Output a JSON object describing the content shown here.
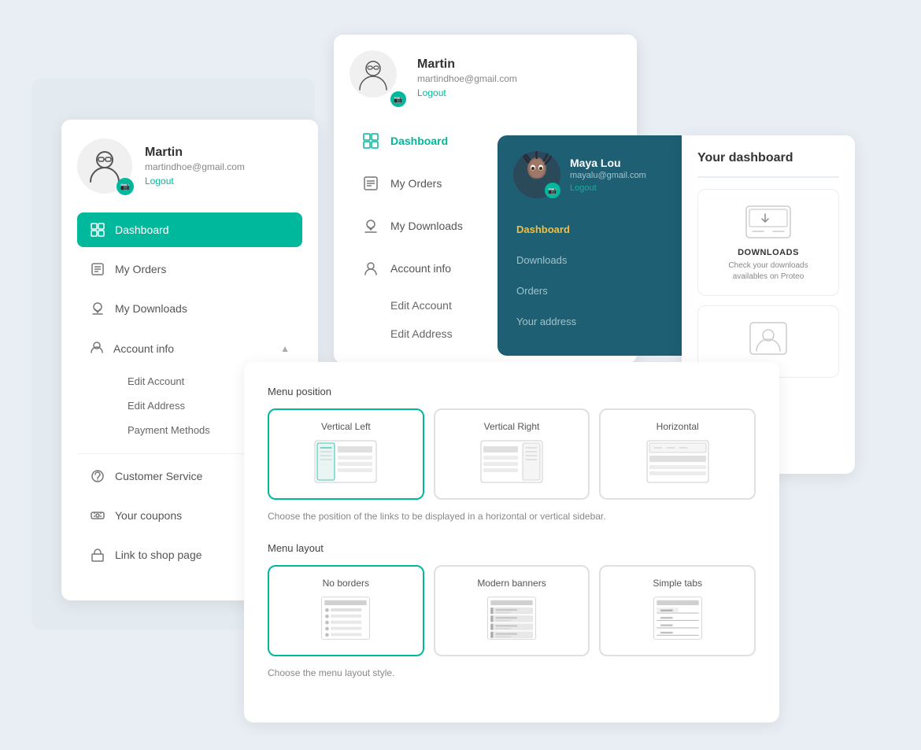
{
  "user1": {
    "name": "Martin",
    "email": "martindhoe@gmail.com",
    "logout": "Logout"
  },
  "user2": {
    "name": "Martin",
    "email": "martindhoe@gmail.com",
    "logout": "Logout"
  },
  "user3": {
    "name": "Maya Lou",
    "email": "mayalu@gmail.com",
    "logout": "Logout"
  },
  "nav1": {
    "dashboard": "Dashboard",
    "myOrders": "My Orders",
    "myDownloads": "My Downloads",
    "accountInfo": "Account info",
    "editAccount": "Edit Account",
    "editAddress": "Edit Address",
    "paymentMethods": "Payment Methods",
    "customerService": "Customer Service",
    "yourCoupons": "Your coupons",
    "linkToShop": "Link to shop page"
  },
  "nav2": {
    "dashboard": "Dashboard",
    "myOrders": "My Orders",
    "myDownloads": "My Downloads",
    "accountInfo": "Account info",
    "editAccount": "Edit Account",
    "editAddress": "Edit Address"
  },
  "nav3": {
    "dashboard": "Dashboard",
    "downloads": "Downloads",
    "orders": "Orders",
    "yourAddress": "Your address"
  },
  "dashboard": {
    "title": "Your dashboard",
    "downloadsTitle": "DOWNLOADS",
    "downloadsDesc": "Check your downloads availables on Proteo"
  },
  "menuPosition": {
    "label": "Menu position",
    "options": [
      {
        "id": "vertical-left",
        "label": "Vertical Left",
        "selected": true
      },
      {
        "id": "vertical-right",
        "label": "Vertical Right",
        "selected": false
      },
      {
        "id": "horizontal",
        "label": "Horizontal",
        "selected": false
      }
    ],
    "description": "Choose the position of the links to be displayed in a horizontal or vertical sidebar."
  },
  "menuLayout": {
    "label": "Menu layout",
    "options": [
      {
        "id": "no-borders",
        "label": "No borders",
        "selected": true
      },
      {
        "id": "modern-banners",
        "label": "Modern banners",
        "selected": false
      },
      {
        "id": "simple-tabs",
        "label": "Simple tabs",
        "selected": false
      }
    ],
    "description": "Choose the menu layout style."
  }
}
